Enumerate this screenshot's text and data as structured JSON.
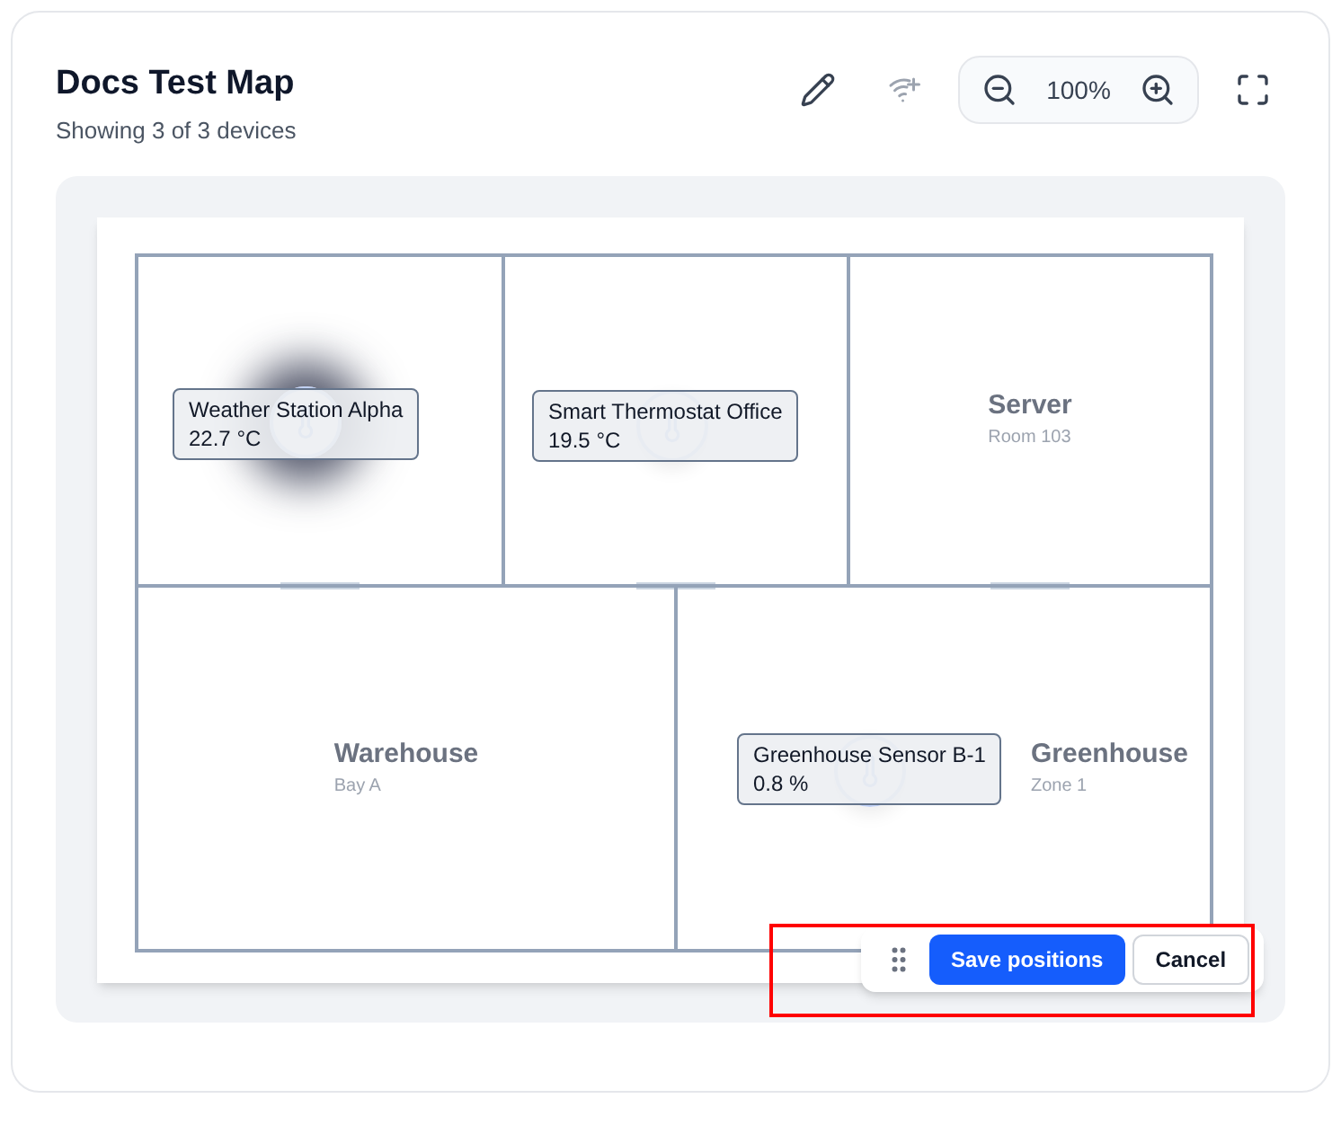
{
  "header": {
    "title": "Docs Test Map",
    "subtitle": "Showing 3 of 3 devices",
    "add_device_disabled": true,
    "zoom": "100%"
  },
  "rooms": [
    {
      "name": "Server",
      "detail": "Room 103"
    },
    {
      "name": "Warehouse",
      "detail": "Bay A"
    },
    {
      "name": "Greenhouse",
      "detail": "Zone 1"
    }
  ],
  "devices": [
    {
      "name": "Weather Station Alpha",
      "reading": "22.7 °C",
      "selected": true
    },
    {
      "name": "Smart Thermostat Office",
      "reading": "19.5 °C",
      "selected": false
    },
    {
      "name": "Greenhouse Sensor B-1",
      "reading": "0.8 %",
      "selected": false
    }
  ],
  "edit_bar": {
    "save": "Save positions",
    "cancel": "Cancel",
    "highlighted": true
  }
}
